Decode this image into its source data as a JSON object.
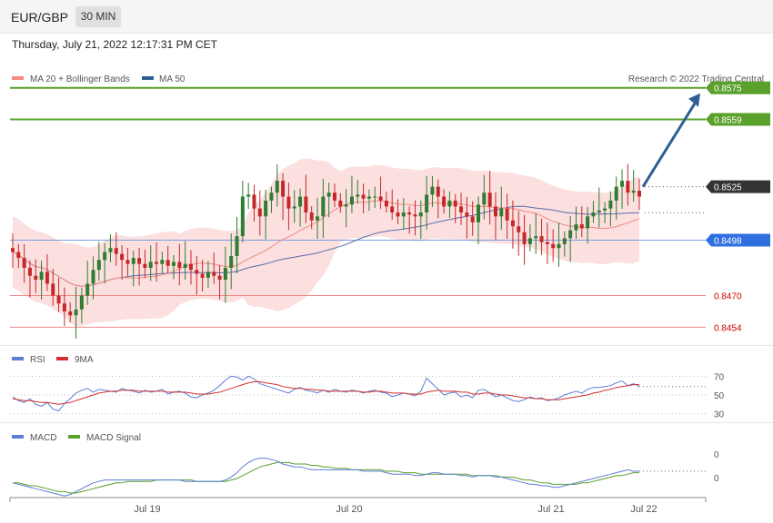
{
  "header": {
    "pair": "EUR/GBP",
    "timeframe": "30 MIN",
    "datetime": "Thursday, July 21, 2022 12:17:31 PM CET"
  },
  "legend": {
    "ma20": "MA 20 + Bollinger Bands",
    "ma50": "MA 50",
    "copyright": "Research © 2022 Trading Central"
  },
  "colors": {
    "up": "#2e7d32",
    "down": "#c62828",
    "ma20": "#f28b82",
    "ma50": "#3f51b5",
    "band": "#fbd9d9",
    "resistance": "#5aa02c",
    "support_line": "#e05050",
    "pivot": "#4a7bd0",
    "arrow": "#2f5f96",
    "rsi": "#5b7fd6",
    "macd": "#5b7fd6",
    "signal": "#5aa02c"
  },
  "chart_data": [
    {
      "type": "candlestick",
      "title": "EUR/GBP",
      "ylim": [
        0.8445,
        0.859
      ],
      "x_ticks": [
        "Jul 19",
        "Jul 20",
        "Jul 21",
        "Jul 22"
      ],
      "levels": [
        {
          "value": 0.8575,
          "label": "0.8575",
          "kind": "resistance"
        },
        {
          "value": 0.8559,
          "label": "0.8559",
          "kind": "resistance"
        },
        {
          "value": 0.8525,
          "label": "0.8525",
          "kind": "current"
        },
        {
          "value": 0.8498,
          "label": "0.8498",
          "kind": "pivot"
        },
        {
          "value": 0.847,
          "label": "0.8470",
          "kind": "support"
        },
        {
          "value": 0.8454,
          "label": "0.8454",
          "kind": "support"
        }
      ],
      "forecast_arrow": {
        "from": 0.8525,
        "to": 0.8575
      },
      "close": [
        0.8492,
        0.8489,
        0.8484,
        0.848,
        0.8478,
        0.8482,
        0.8476,
        0.847,
        0.8466,
        0.8462,
        0.846,
        0.8463,
        0.847,
        0.8476,
        0.8483,
        0.8488,
        0.8492,
        0.8494,
        0.8491,
        0.8488,
        0.8486,
        0.8489,
        0.8486,
        0.8484,
        0.8487,
        0.8486,
        0.8488,
        0.8485,
        0.8487,
        0.8484,
        0.8486,
        0.8483,
        0.8481,
        0.8479,
        0.8482,
        0.848,
        0.8478,
        0.8484,
        0.849,
        0.85,
        0.852,
        0.8521,
        0.8514,
        0.851,
        0.8518,
        0.8522,
        0.8528,
        0.852,
        0.8514,
        0.8515,
        0.852,
        0.8512,
        0.8508,
        0.851,
        0.852,
        0.8522,
        0.8518,
        0.8515,
        0.8516,
        0.852,
        0.8521,
        0.8519,
        0.852,
        0.852,
        0.8518,
        0.8515,
        0.8512,
        0.851,
        0.8512,
        0.8511,
        0.851,
        0.8512,
        0.8521,
        0.8525,
        0.852,
        0.8515,
        0.8518,
        0.8515,
        0.8512,
        0.851,
        0.8507,
        0.8516,
        0.8522,
        0.8515,
        0.851,
        0.8514,
        0.8508,
        0.8505,
        0.8502,
        0.8496,
        0.8499,
        0.85,
        0.8497,
        0.8496,
        0.8494,
        0.8496,
        0.8499,
        0.8503,
        0.8506,
        0.8504,
        0.851,
        0.8512,
        0.8513,
        0.8514,
        0.8518,
        0.8525,
        0.8528,
        0.8522,
        0.8523,
        0.852
      ],
      "ma_colors_note": "MA 20 red, MA 50 blue"
    },
    {
      "type": "line",
      "title": "RSI",
      "ylim": [
        20,
        80
      ],
      "y_ticks": [
        70,
        50,
        30
      ],
      "series": [
        {
          "name": "RSI",
          "values": [
            48,
            44,
            42,
            46,
            40,
            38,
            42,
            35,
            33,
            41,
            46,
            52,
            55,
            57,
            53,
            56,
            55,
            54,
            53,
            57,
            55,
            54,
            52,
            55,
            53,
            54,
            56,
            51,
            53,
            54,
            52,
            48,
            47,
            50,
            52,
            55,
            60,
            66,
            70,
            69,
            66,
            70,
            67,
            62,
            60,
            58,
            56,
            54,
            52,
            56,
            58,
            55,
            54,
            52,
            55,
            53,
            56,
            54,
            53,
            55,
            54,
            52,
            54,
            55,
            53,
            52,
            48,
            50,
            52,
            51,
            49,
            54,
            68,
            62,
            56,
            50,
            52,
            53,
            48,
            50,
            47,
            55,
            56,
            52,
            48,
            50,
            47,
            44,
            43,
            45,
            48,
            46,
            47,
            44,
            45,
            47,
            50,
            52,
            54,
            52,
            56,
            58,
            58,
            59,
            60,
            63,
            65,
            60,
            62,
            59
          ]
        },
        {
          "name": "9MA",
          "values": [
            46,
            45,
            44,
            44,
            43,
            42,
            42,
            41,
            40,
            41,
            42,
            44,
            46,
            48,
            50,
            52,
            53,
            54,
            54,
            55,
            55,
            55,
            54,
            54,
            54,
            54,
            54,
            53,
            53,
            53,
            53,
            52,
            51,
            51,
            51,
            52,
            53,
            55,
            57,
            59,
            61,
            63,
            64,
            64,
            63,
            62,
            61,
            59,
            58,
            57,
            57,
            56,
            56,
            55,
            55,
            54,
            54,
            54,
            54,
            54,
            54,
            53,
            53,
            54,
            54,
            53,
            52,
            52,
            52,
            51,
            51,
            51,
            53,
            54,
            55,
            54,
            54,
            54,
            53,
            53,
            51,
            51,
            52,
            52,
            51,
            50,
            50,
            49,
            48,
            47,
            47,
            46,
            46,
            45,
            45,
            45,
            46,
            47,
            48,
            49,
            50,
            52,
            53,
            55,
            56,
            58,
            59,
            60,
            61,
            61
          ]
        }
      ]
    },
    {
      "type": "line",
      "title": "MACD",
      "y_ticks": [
        0,
        0
      ],
      "series": [
        {
          "name": "MACD",
          "values": [
            -3,
            -4,
            -5,
            -6,
            -7,
            -8,
            -9,
            -10,
            -11,
            -12,
            -11,
            -9,
            -7,
            -5,
            -3,
            -2,
            -1,
            -1,
            -1,
            -1,
            -1,
            -1,
            -1,
            -1,
            -1,
            -1,
            -1,
            -1,
            -1,
            -1,
            -2,
            -2,
            -2,
            -2,
            -2,
            -2,
            -2,
            -1,
            1,
            4,
            8,
            11,
            13,
            14,
            14,
            13,
            12,
            10,
            9,
            8,
            8,
            7,
            6,
            6,
            6,
            6,
            6,
            6,
            6,
            6,
            6,
            5,
            5,
            5,
            5,
            4,
            3,
            3,
            3,
            3,
            2,
            2,
            3,
            4,
            4,
            3,
            3,
            3,
            2,
            2,
            1,
            2,
            2,
            2,
            1,
            1,
            0,
            -1,
            -2,
            -3,
            -4,
            -4,
            -5,
            -5,
            -6,
            -6,
            -5,
            -4,
            -3,
            -2,
            -1,
            0,
            1,
            2,
            3,
            4,
            5,
            6,
            5,
            5
          ]
        },
        {
          "name": "MACD Signal",
          "values": [
            -3,
            -3,
            -4,
            -5,
            -5,
            -6,
            -7,
            -8,
            -9,
            -9,
            -10,
            -10,
            -9,
            -8,
            -7,
            -6,
            -5,
            -4,
            -3,
            -3,
            -2,
            -2,
            -2,
            -2,
            -2,
            -1,
            -1,
            -1,
            -1,
            -1,
            -1,
            -1,
            -2,
            -2,
            -2,
            -2,
            -2,
            -2,
            -1,
            0,
            2,
            4,
            6,
            8,
            9,
            10,
            11,
            11,
            11,
            10,
            10,
            10,
            9,
            9,
            8,
            8,
            7,
            7,
            7,
            6,
            6,
            6,
            6,
            6,
            6,
            5,
            5,
            5,
            4,
            4,
            4,
            3,
            3,
            3,
            3,
            3,
            3,
            3,
            3,
            3,
            2,
            2,
            2,
            2,
            2,
            1,
            1,
            1,
            0,
            -1,
            -1,
            -2,
            -3,
            -3,
            -4,
            -4,
            -4,
            -4,
            -4,
            -3,
            -3,
            -2,
            -1,
            0,
            1,
            2,
            2,
            3,
            4,
            4
          ]
        }
      ]
    }
  ]
}
